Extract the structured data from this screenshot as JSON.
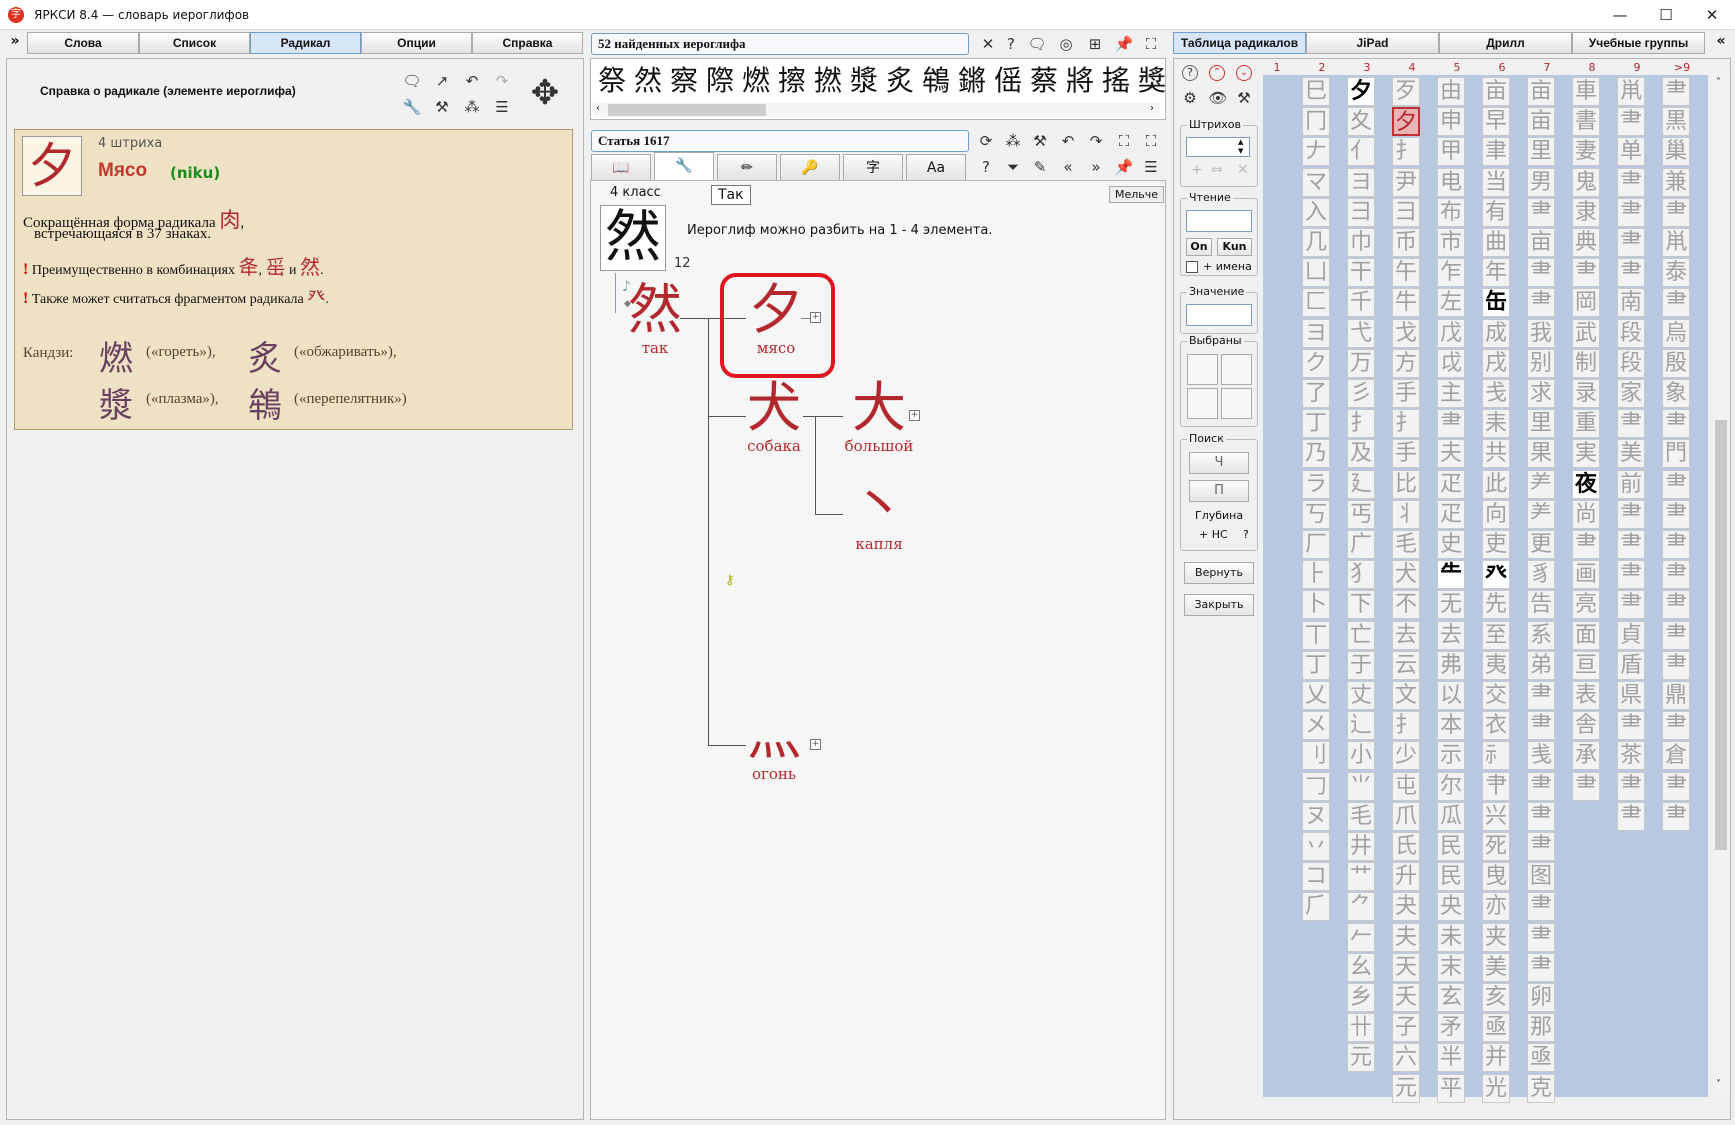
{
  "window": {
    "title": "ЯРКСИ 8.4 — словарь иероглифов",
    "logo": "字"
  },
  "nav_tabs": [
    "Слова",
    "Список",
    "Радикал",
    "Опции",
    "Справка"
  ],
  "nav_active": 2,
  "right_tabs": [
    "Таблица радикалов",
    "JiPad",
    "Дрилл",
    "Учебные группы"
  ],
  "left": {
    "heading": "Справка о радикале  (элементе иероглифа)",
    "radical": "夕",
    "strokes": "4  штриха",
    "name": "Мясо",
    "reading": "(niku)",
    "desc1": "Сокращённая форма радикала",
    "desc_kanji": "肉",
    "desc2": "встречающаяся в 37 знаках.",
    "note1": "Преимущественно в комбинациях",
    "note1_k1": "夅",
    "note1_sep": ",",
    "note1_k2": "䍃",
    "note1_and": "и",
    "note1_k3": "然",
    "note2": "Также может считаться фрагментом радикала",
    "note2_k": "癶",
    "kanji_label": "Кандзи:",
    "examples": [
      {
        "k": "燃",
        "m": "(«гореть»),"
      },
      {
        "k": "炙",
        "m": "(«обжаривать»),"
      },
      {
        "k": "漿",
        "m": "(«плазма»),"
      },
      {
        "k": "鴾",
        "m": "(«перепелятник»)"
      }
    ]
  },
  "middle": {
    "found": "52 найденных иероглифа",
    "strip": [
      "祭",
      "然",
      "察",
      "際",
      "燃",
      "擦",
      "撚",
      "漿",
      "炙",
      "鴾",
      "鏘",
      "傜",
      "蔡",
      "將",
      "搖",
      "獎"
    ],
    "article": "Статья 1617",
    "subtabs": [
      "📖",
      "🔧",
      "✏",
      "🔑",
      "字",
      "Aa"
    ],
    "grade": "4 класс",
    "tooltip": "Так",
    "smaller": "Мельче",
    "main_kanji": "然",
    "stroke_count": "12",
    "split_text": "Иероглиф можно разбить на  1 - 4  элемента.",
    "tree": {
      "root": {
        "k": "然",
        "t": "так"
      },
      "meat": {
        "k": "夕",
        "t": "мясо"
      },
      "dog": {
        "k": "犬",
        "t": "собака"
      },
      "big": {
        "k": "大",
        "t": "большой"
      },
      "drop": {
        "k": "丶",
        "t": "капля"
      },
      "fire": {
        "k": "灬",
        "t": "огонь"
      }
    }
  },
  "controls": {
    "strokes_label": "Штрихов",
    "reading_label": "Чтение",
    "on": "On",
    "kun": "Kun",
    "names": "+ имена",
    "meaning_label": "Значение",
    "selected_label": "Выбраны",
    "search_label": "Поиск",
    "search_ch": "Ч",
    "search_p": "П",
    "depth": "Глубина",
    "depth_hs": "+ НС",
    "depth_q": "?",
    "back": "Вернуть",
    "close": "Закрыть"
  },
  "grid": {
    "col_labels": [
      "1",
      "2",
      "3",
      "4",
      "5",
      "6",
      "7",
      "8",
      "9",
      ">9"
    ],
    "columns": [
      [
        "巳",
        "冂",
        "𠂇",
        "マ",
        "入",
        "几",
        "凵",
        "匚",
        "ヨ",
        "ク",
        "了",
        "丁",
        "乃",
        "ラ",
        "丂",
        "厂",
        "⺊",
        "卜",
        "丅",
        "丁",
        "乂",
        "メ",
        "刂",
        "𠃌",
        "ヌ",
        "丷",
        "コ",
        "⺁"
      ],
      [
        "夕",
        "夊",
        "亻",
        "ヨ",
        "彐",
        "巾",
        "干",
        "千",
        "弋",
        "万",
        "彡",
        "⺘",
        "及",
        "廴",
        "丐",
        "广",
        "犭",
        "下",
        "亡",
        "于",
        "丈",
        "⻌",
        "小",
        "⺌",
        "毛",
        "井",
        "⺾",
        "⺈",
        "𠂉",
        "幺",
        "乡",
        "卄",
        "元"
      ],
      [
        "歹",
        "夕",
        "⺘",
        "尹",
        "⺕",
        "币",
        "午",
        "牛",
        "戈",
        "方",
        "手",
        "⺘",
        "手",
        "比",
        "⺦",
        "毛",
        "犬",
        "不",
        "去",
        "云",
        "文",
        "⺘",
        "少",
        "屯",
        "爪",
        "氏",
        "升",
        "夬",
        "夫",
        "天",
        "夭",
        "子",
        "六",
        "元"
      ],
      [
        "由",
        "申",
        "甲",
        "电",
        "布",
        "市",
        "乍",
        "左",
        "戊",
        "戉",
        "主",
        "⺻",
        "夫",
        "疋",
        "疋",
        "史",
        "⺧",
        "无",
        "去",
        "弗",
        "以",
        "本",
        "示",
        "尔",
        "瓜",
        "民",
        "民",
        "央",
        "未",
        "末",
        "玄",
        "矛",
        "半",
        "平"
      ],
      [
        "亩",
        "早",
        "聿",
        "当",
        "有",
        "曲",
        "年",
        "缶",
        "成",
        "戌",
        "戋",
        "耒",
        "共",
        "此",
        "向",
        "吏",
        "癶",
        "先",
        "至",
        "夷",
        "交",
        "衣",
        "⺬",
        "⺺",
        "兴",
        "死",
        "曳",
        "亦",
        "夹",
        "美",
        "亥",
        "亟",
        "并",
        "光"
      ],
      [
        "亩",
        "亩",
        "里",
        "男",
        "⺻",
        "亩",
        "⺻",
        "⺻",
        "我",
        "别",
        "求",
        "里",
        "果",
        "⺶",
        "⺶",
        "更",
        "豸",
        "告",
        "系",
        "弟",
        "⺻",
        "⺻",
        "㦮",
        "⺻",
        "⺻",
        "⺻",
        "图",
        "⺻",
        "⺻",
        "⺻",
        "卵",
        "那",
        "亟",
        "克"
      ],
      [
        "車",
        "書",
        "妻",
        "⻤",
        "隶",
        "典",
        "⺻",
        "岡",
        "武",
        "制",
        "录",
        "重",
        "実",
        "夜",
        "尚",
        "⺻",
        "画",
        "亮",
        "面",
        "亘",
        "表",
        "舎",
        "承",
        "⺻"
      ],
      [
        "鼡",
        "⺻",
        "单",
        "⺻",
        "⺻",
        "⺻",
        "⺻",
        "南",
        "段",
        "段",
        "家",
        "⺻",
        "美",
        "前",
        "⺻",
        "⺻",
        "⺻",
        "⺻",
        "貞",
        "盾",
        "県",
        "⺻",
        "茶",
        "⺻",
        "⺻"
      ],
      [
        "⺻",
        "黒",
        "巢",
        "兼",
        "⺻",
        "鼡",
        "泰",
        "⺻",
        "烏",
        "殷",
        "象",
        "⺻",
        "門",
        "⺻",
        "⺻",
        "⺻",
        "⺻",
        "⺻",
        "⺻",
        "⺻",
        "鼎",
        "⺻",
        "倉",
        "⺻",
        "⺻"
      ]
    ]
  }
}
